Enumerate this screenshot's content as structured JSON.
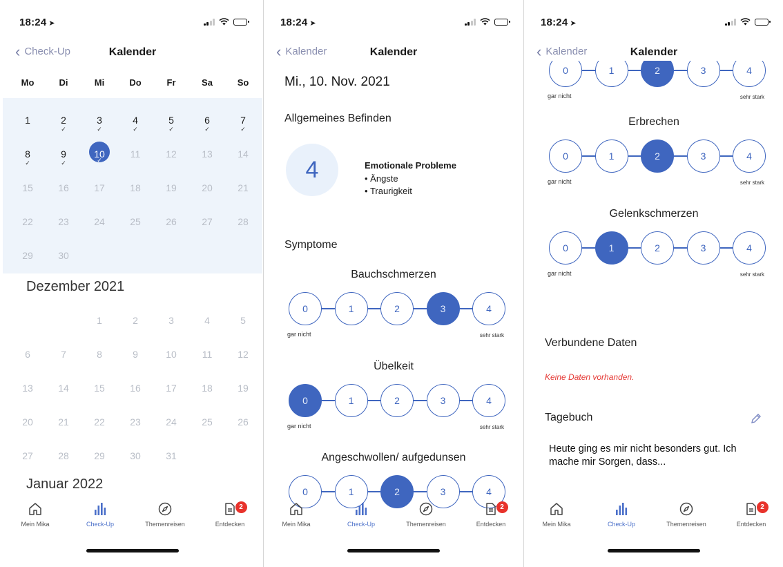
{
  "status": {
    "time": "18:24",
    "location_icon": "location-arrow-icon"
  },
  "tabs": [
    {
      "label": "Mein Mika",
      "icon": "home-icon"
    },
    {
      "label": "Check-Up",
      "icon": "bar-chart-icon"
    },
    {
      "label": "Themenreisen",
      "icon": "compass-icon"
    },
    {
      "label": "Entdecken",
      "icon": "document-icon",
      "badge": "2"
    }
  ],
  "screen1": {
    "back_label": "Check-Up",
    "title": "Kalender",
    "weekdays": [
      "Mo",
      "Di",
      "Mi",
      "Do",
      "Fr",
      "Sa",
      "So"
    ],
    "november_days": [
      "1",
      "2",
      "3",
      "4",
      "5",
      "6",
      "7",
      "8",
      "9",
      "10",
      "11",
      "12",
      "13",
      "14",
      "15",
      "16",
      "17",
      "18",
      "19",
      "20",
      "21",
      "22",
      "23",
      "24",
      "25",
      "26",
      "27",
      "28",
      "29",
      "30"
    ],
    "checked_days": [
      "2",
      "3",
      "4",
      "5",
      "6",
      "7",
      "8",
      "9",
      "10"
    ],
    "selected_day": "10",
    "month_dec": "Dezember 2021",
    "december_days": [
      "1",
      "2",
      "3",
      "4",
      "5",
      "6",
      "7",
      "8",
      "9",
      "10",
      "11",
      "12",
      "13",
      "14",
      "15",
      "16",
      "17",
      "18",
      "19",
      "20",
      "21",
      "22",
      "23",
      "24",
      "25",
      "26",
      "27",
      "28",
      "29",
      "30",
      "31"
    ],
    "month_jan": "Januar 2022"
  },
  "screen2": {
    "back_label": "Kalender",
    "title": "Kalender",
    "date": "Mi., 10. Nov. 2021",
    "wellbeing_title": "Allgemeines Befinden",
    "wellbeing_value": "4",
    "emotional_title": "Emotionale Probleme",
    "emotional_items": [
      "Ängste",
      "Traurigkeit"
    ],
    "symptoms_title": "Symptome",
    "symptoms": [
      {
        "name": "Bauchschmerzen",
        "value": 3
      },
      {
        "name": "Übelkeit",
        "value": 0
      },
      {
        "name": "Angeschwollen/ aufgedunsen",
        "value": 2
      }
    ]
  },
  "screen3": {
    "back_label": "Kalender",
    "title": "Kalender",
    "top_partial_value": 2,
    "symptoms": [
      {
        "name": "Erbrechen",
        "value": 2
      },
      {
        "name": "Gelenkschmerzen",
        "value": 1
      }
    ],
    "connected_title": "Verbundene Daten",
    "no_data": "Keine Daten vorhanden.",
    "diary_title": "Tagebuch",
    "diary_text": "Heute ging es mir nicht besonders gut. Ich mache mir Sorgen, dass...",
    "edit_icon": "pencil-icon"
  },
  "scale": {
    "options": [
      "0",
      "1",
      "2",
      "3",
      "4"
    ],
    "min_label": "gar nicht",
    "max_label": "sehr stark"
  },
  "colors": {
    "accent": "#3f66bf",
    "calendar_bg": "#eef4fb",
    "alert": "#e53935",
    "badge": "#e8322b"
  }
}
